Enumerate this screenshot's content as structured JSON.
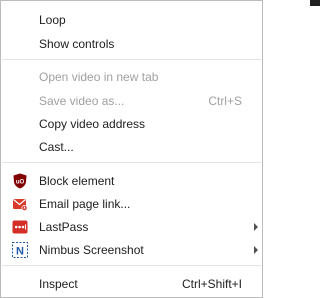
{
  "context_menu": {
    "loop": "Loop",
    "show_controls": "Show controls",
    "open_video_new_tab": "Open video in new tab",
    "save_video_as": "Save video as...",
    "save_video_as_shortcut": "Ctrl+S",
    "copy_video_address": "Copy video address",
    "cast": "Cast...",
    "block_element": "Block element",
    "email_page_link": "Email page link...",
    "lastpass": "LastPass",
    "nimbus_screenshot": "Nimbus Screenshot",
    "inspect": "Inspect",
    "inspect_shortcut": "Ctrl+Shift+I",
    "icons": {
      "block_element": "ublock-origin-icon",
      "email_page_link": "email-icon",
      "lastpass": "lastpass-icon",
      "nimbus_screenshot": "nimbus-screenshot-icon"
    },
    "colors": {
      "ublock_red": "#800000",
      "email_red": "#d93b2b",
      "lastpass_red": "#d32d27",
      "nimbus_blue": "#1e5aa8",
      "disabled_text": "#a0a0a0"
    }
  }
}
